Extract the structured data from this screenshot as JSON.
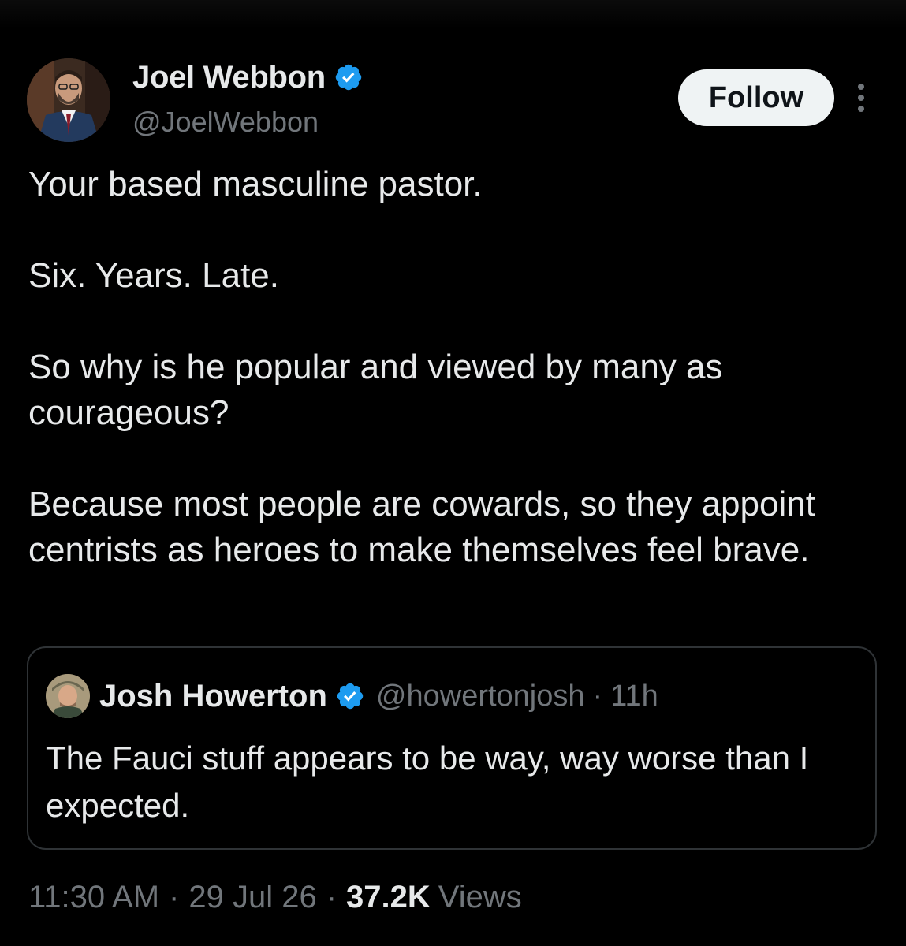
{
  "author": {
    "display_name": "Joel Webbon",
    "handle": "@JoelWebbon",
    "verified_icon": "verified-badge-icon"
  },
  "actions": {
    "follow_label": "Follow",
    "more_icon": "more-vertical-icon"
  },
  "tweet": {
    "paragraphs": [
      "Your based masculine pastor.",
      "Six. Years. Late.",
      "So why is he popular and viewed by many as courageous?",
      "Because most people are cowards, so they appoint centrists as heroes to make themselves feel brave."
    ]
  },
  "quoted": {
    "display_name": "Josh Howerton",
    "handle": "@howertonjosh",
    "separator": "·",
    "time": "11h",
    "text": "The Fauci stuff appears to be way, way worse than I expected."
  },
  "meta": {
    "time": "11:30 AM",
    "separator": "·",
    "date": "29 Jul 26",
    "views_count": "37.2K",
    "views_label": "Views"
  },
  "colors": {
    "background": "#000000",
    "text_primary": "#e7e9ea",
    "text_secondary": "#71767b",
    "verified_blue": "#1d9bf0",
    "follow_bg": "#eff3f4",
    "border": "#2f3336"
  }
}
